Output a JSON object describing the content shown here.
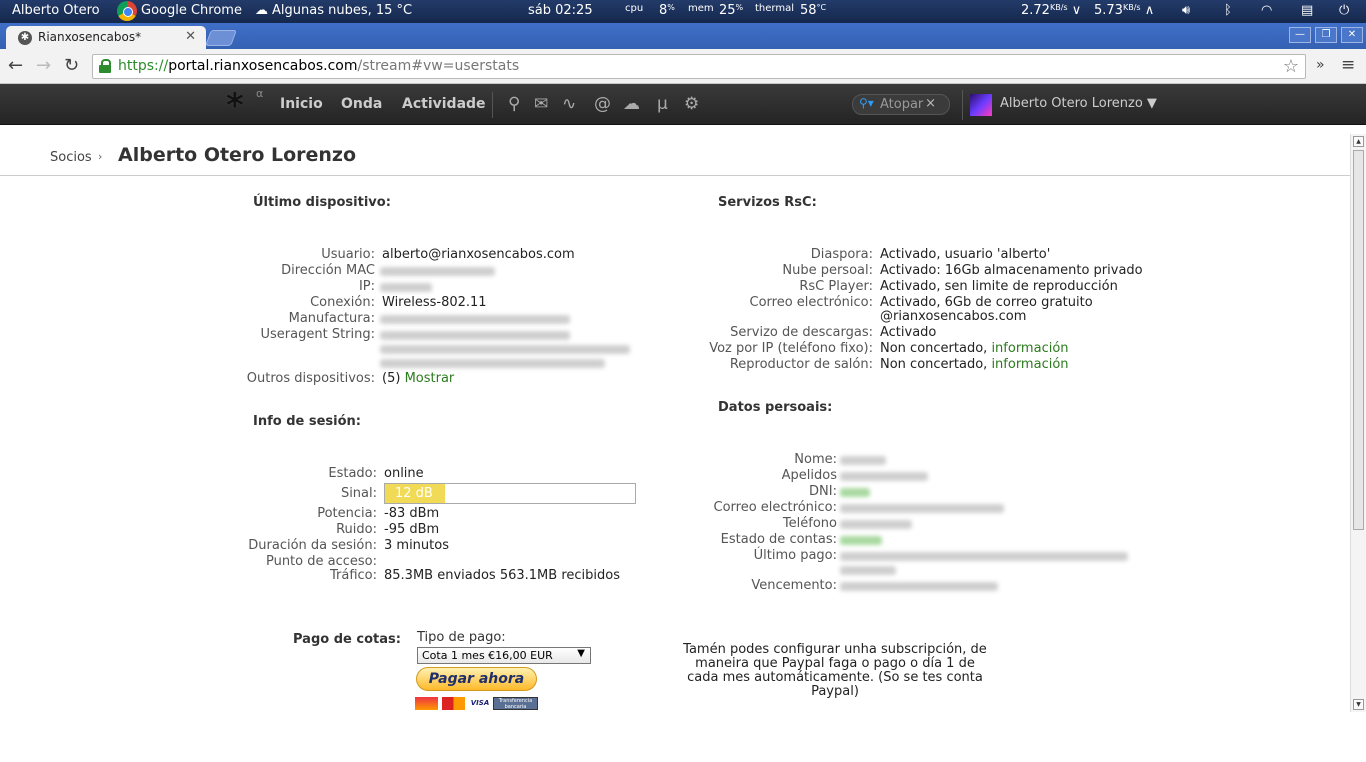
{
  "os_panel": {
    "user": "Alberto Otero",
    "app": "Google Chrome",
    "weather": "Algunas nubes, 15 °C",
    "clock": "sáb 02:25",
    "cpu_label": "cpu",
    "cpu_value": "8",
    "cpu_unit": "%",
    "mem_label": "mem",
    "mem_value": "25",
    "mem_unit": "%",
    "thermal_label": "thermal",
    "thermal_value": "58",
    "thermal_unit": "°C",
    "down_speed": "2.72",
    "down_unit": "KB/s",
    "up_speed": "5.73",
    "up_unit": "KB/s"
  },
  "browser": {
    "tab_title": "Rianxosencabos*",
    "url_scheme": "https://",
    "url_host": "portal.rianxosencabos.com",
    "url_path": "/stream#vw=userstats"
  },
  "site_nav": {
    "logo": "*",
    "alpha": "α",
    "links": [
      "Inicio",
      "Onda",
      "Actividade"
    ],
    "search_placeholder": "Atopar",
    "user_name": "Alberto Otero Lorenzo ▼"
  },
  "breadcrumb": {
    "root": "Socios",
    "current": "Alberto Otero Lorenzo"
  },
  "device": {
    "title": "Último dispositivo:",
    "usuario_label": "Usuario:",
    "usuario_value": "alberto@rianxosencabos.com",
    "mac_label": "Dirección MAC",
    "ip_label": "IP:",
    "conexion_label": "Conexión:",
    "conexion_value": "Wireless-802.11",
    "manufactura_label": "Manufactura:",
    "useragent_label": "Useragent String:",
    "outros_label": "Outros dispositivos:",
    "outros_count": "(5)",
    "outros_link": "Mostrar"
  },
  "session": {
    "title": "Info de sesión:",
    "estado_label": "Estado:",
    "estado_value": "online",
    "sinal_label": "Sinal:",
    "sinal_value": "12 dB",
    "sinal_fraction": 0.24,
    "potencia_label": "Potencia:",
    "potencia_value": "-83 dBm",
    "ruido_label": "Ruido:",
    "ruido_value": "-95 dBm",
    "duracion_label": "Duración da sesión:",
    "duracion_value": "3 minutos",
    "punto_label": "Punto de acceso:",
    "trafico_label": "Tráfico:",
    "trafico_value": "85.3MB enviados 563.1MB recibidos"
  },
  "services": {
    "title": "Servizos RsC:",
    "diaspora_label": "Diaspora:",
    "diaspora_value": "Activado, usuario 'alberto'",
    "nube_label": "Nube persoal:",
    "nube_value": "Activado: 16Gb almacenamento privado",
    "player_label": "RsC Player:",
    "player_value": "Activado, sen limite de reproducción",
    "correo_label": "Correo electrónico:",
    "correo_value1": "Activado, 6Gb de correo gratuito",
    "correo_value2": "@rianxosencabos.com",
    "descargas_label": "Servizo de descargas:",
    "descargas_value": "Activado",
    "voz_label": "Voz por IP (teléfono fixo):",
    "voz_value": "Non concertado,",
    "voz_link": "información",
    "salon_label": "Reproductor de salón:",
    "salon_value": "Non concertado,",
    "salon_link": "información"
  },
  "personal": {
    "title": "Datos persoais:",
    "nome_label": "Nome:",
    "apelidos_label": "Apelidos",
    "dni_label": "DNI:",
    "correo_label": "Correo electrónico:",
    "telefono_label": "Teléfono",
    "contas_label": "Estado de contas:",
    "pago_label": "Último pago:",
    "vencemento_label": "Vencemento:"
  },
  "payment": {
    "label": "Pago de cotas:",
    "type_label": "Tipo de pago:",
    "selected": "Cota 1 mes €16,00 EUR",
    "button": "Pagar ahora",
    "cards": [
      "",
      "",
      "VISA",
      "Transferencia bancaria"
    ],
    "note": "Tamén podes configurar unha subscripción, de maneira que Paypal faga o pago o día 1 de cada mes automáticamente. (So se tes conta Paypal)"
  }
}
